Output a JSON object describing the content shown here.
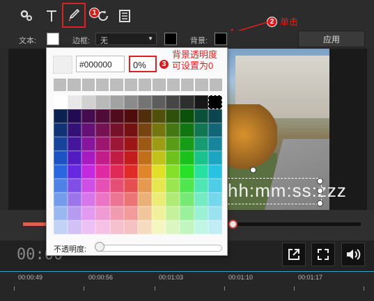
{
  "toolbar": {
    "icons": [
      "settings-gears-icon",
      "text-icon",
      "eyedropper-icon",
      "rotate-icon",
      "save-icon"
    ]
  },
  "props": {
    "text_label": "文本:",
    "border_label": "边框:",
    "border_value": "无",
    "background_label": "背景:",
    "apply_label": "应用"
  },
  "preview": {
    "overlay_text": "hh:mm:ss:zzz"
  },
  "controls": {
    "timecode": "00:00"
  },
  "ruler": {
    "ticks": [
      "00:00:49",
      "00:00:56",
      "00:01:03",
      "00:01:10",
      "00:01:17"
    ]
  },
  "picker": {
    "hex_value": "#000000",
    "percent_value": "0%",
    "opacity_label": "不透明度:",
    "opacity_value": 0
  },
  "annotations": {
    "step1": "1",
    "step2": "2",
    "step3": "3",
    "click_label": "单击",
    "bg_opacity_line1": "背景透明度",
    "bg_opacity_line2": "可设置为0"
  },
  "colors": {
    "accent_red": "#e02020",
    "apply_bg": "#3a3a3a",
    "seek_progress": "#e06050"
  }
}
